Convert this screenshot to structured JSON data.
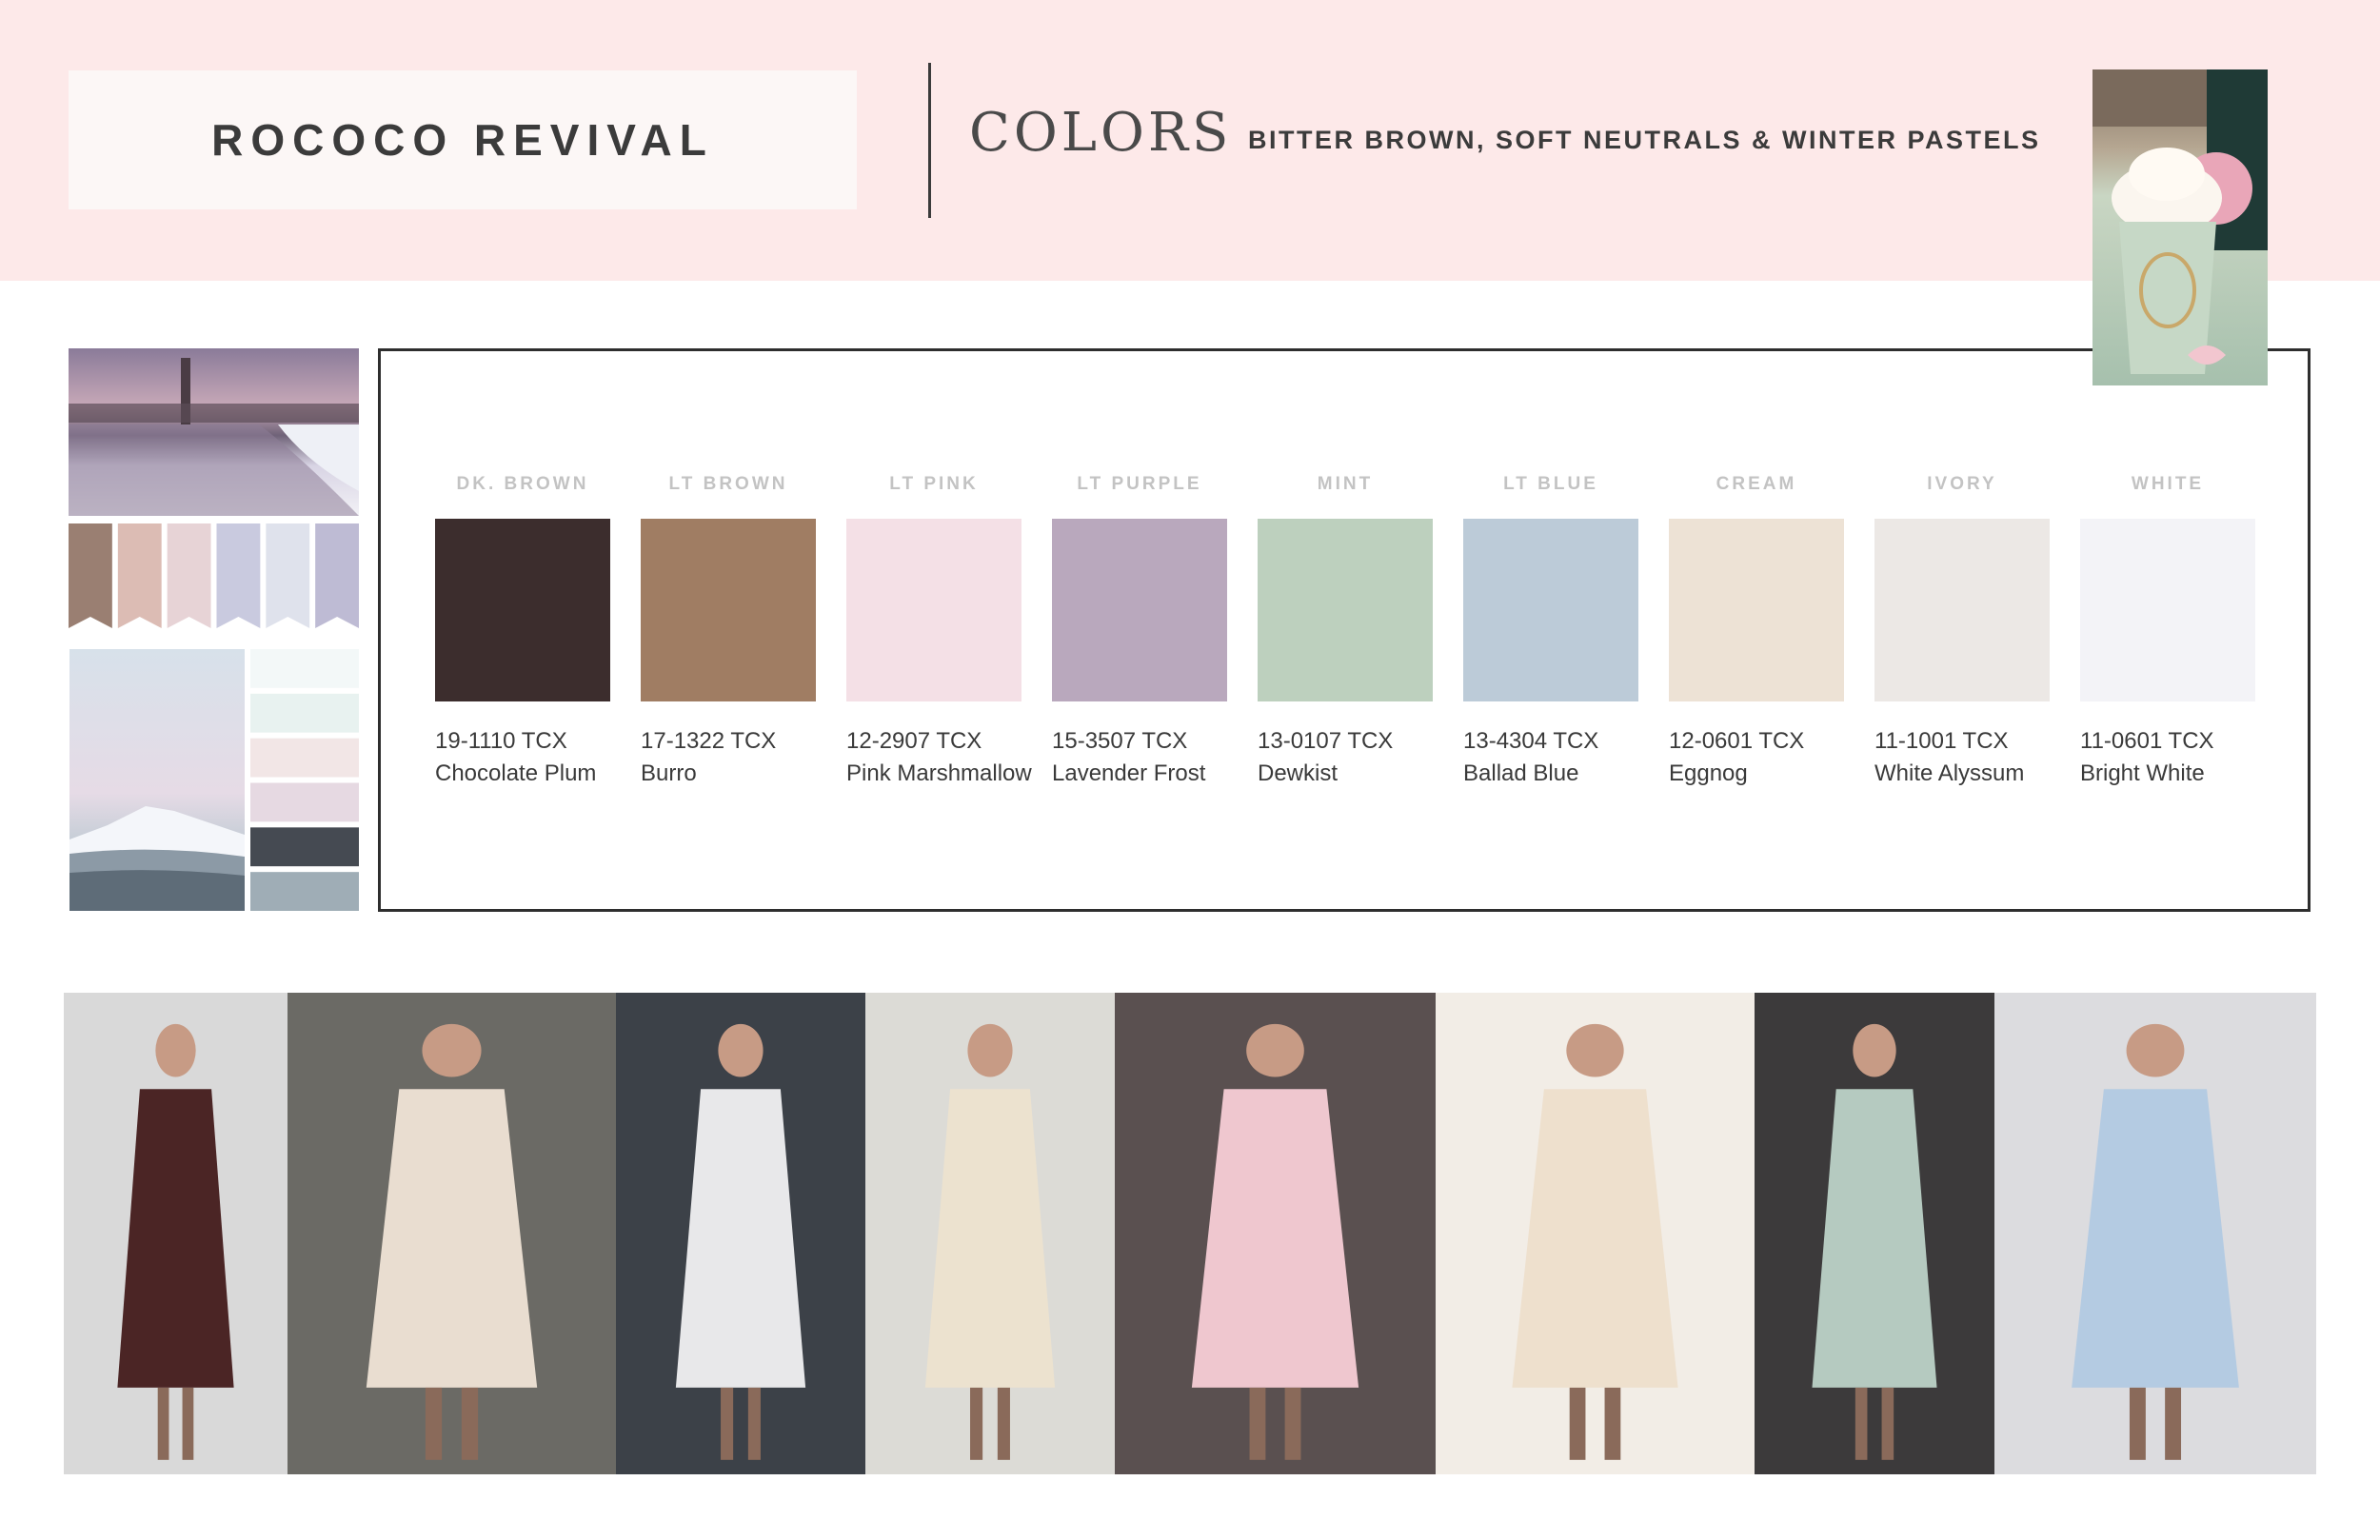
{
  "header": {
    "title": "ROCOCO REVIVAL",
    "section": "COLORS",
    "subtitle": "BITTER BROWN, SOFT NEUTRALS & WINTER PASTELS",
    "background": "#fde9e9"
  },
  "swatches": [
    {
      "label": "DK. BROWN",
      "color": "#3c2d2d",
      "code": "19-1110 TCX",
      "name": "Chocolate Plum"
    },
    {
      "label": "LT BROWN",
      "color": "#a07d63",
      "code": "17-1322 TCX",
      "name": "Burro"
    },
    {
      "label": "LT PINK",
      "color": "#f4e0e6",
      "code": "12-2907 TCX",
      "name": "Pink Marshmallow"
    },
    {
      "label": "LT PURPLE",
      "color": "#b9a8bd",
      "code": "15-3507 TCX",
      "name": "Lavender Frost"
    },
    {
      "label": "MINT",
      "color": "#bdd0be",
      "code": "13-0107 TCX",
      "name": "Dewkist"
    },
    {
      "label": "LT BLUE",
      "color": "#bccbd8",
      "code": "13-4304 TCX",
      "name": "Ballad Blue"
    },
    {
      "label": "CREAM",
      "color": "#ede2d5",
      "code": "12-0601 TCX",
      "name": "Eggnog"
    },
    {
      "label": "IVORY",
      "color": "#ece8e5",
      "code": "11-1001 TCX",
      "name": "White Alyssum"
    },
    {
      "label": "WHITE",
      "color": "#f3f3f7",
      "code": "11-0601 TCX",
      "name": "Bright White"
    }
  ],
  "side_palette_top": [
    "#9a7f72",
    "#dcbcb4",
    "#e7d3d6",
    "#c9cadf",
    "#dfe2ec",
    "#bebbd4"
  ],
  "side_palette_bottom": [
    "#f3f8f8",
    "#e8f2f0",
    "#f2e6e6",
    "#e6d9e2",
    "#454a52",
    "#9fadb6"
  ],
  "photos": [
    {
      "name": "photo-brown-gown",
      "palette": [
        "#d9d9d9",
        "#4b2525"
      ]
    },
    {
      "name": "photo-cream-slip-dress",
      "palette": [
        "#6b6a65",
        "#e9ddd0"
      ]
    },
    {
      "name": "photo-floral-dress-street",
      "palette": [
        "#3c4148",
        "#e8e8ea"
      ]
    },
    {
      "name": "photo-dog-cream-outfit",
      "palette": [
        "#dcdbd6",
        "#ece2cf"
      ]
    },
    {
      "name": "photo-pink-skirt",
      "palette": [
        "#5a5050",
        "#efc7cf"
      ]
    },
    {
      "name": "photo-lace-dress",
      "palette": [
        "#f2ede6",
        "#eee0cd"
      ]
    },
    {
      "name": "photo-mint-slip",
      "palette": [
        "#3c3a3b",
        "#b5cac0"
      ]
    },
    {
      "name": "photo-blue-suits",
      "palette": [
        "#dcdcdf",
        "#b4cbe2"
      ]
    }
  ]
}
